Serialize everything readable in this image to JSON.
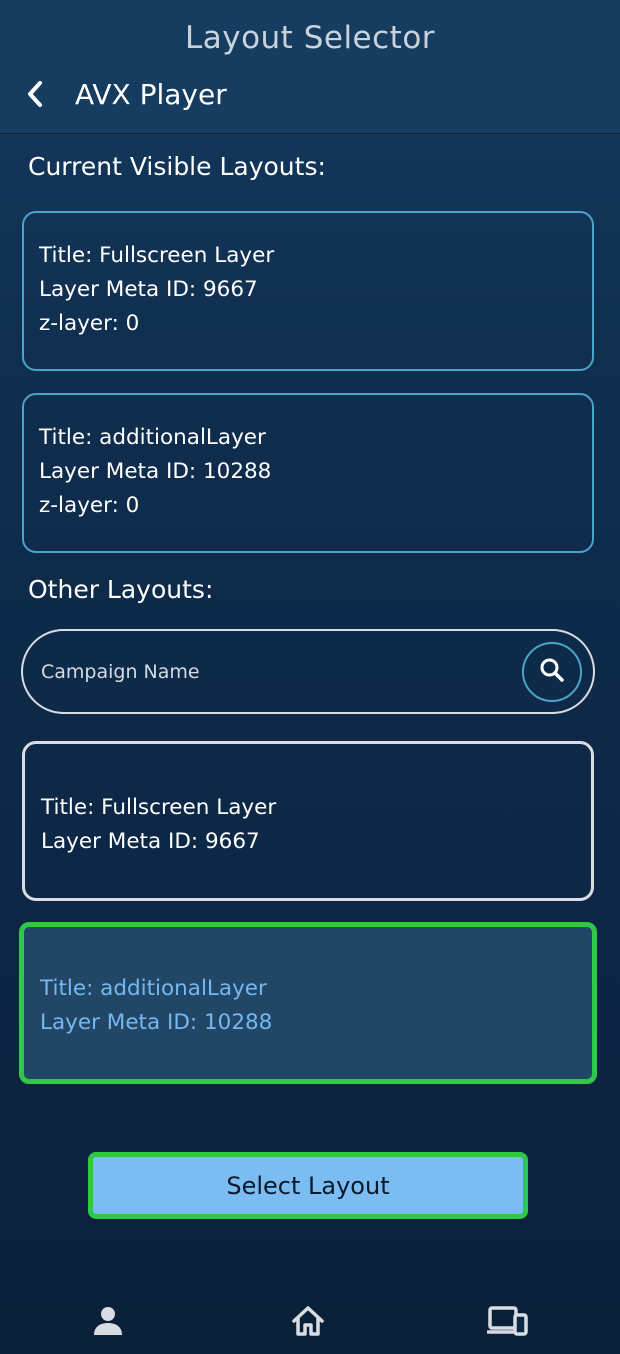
{
  "header": {
    "title": "Layout Selector",
    "back_label": "AVX Player"
  },
  "current_section": {
    "title": "Current Visible Layouts:",
    "cards": [
      {
        "title": "Title: Fullscreen Layer",
        "meta": "Layer Meta ID: 9667",
        "z": "z-layer: 0"
      },
      {
        "title": "Title: additionalLayer",
        "meta": "Layer Meta ID: 10288",
        "z": "z-layer: 0"
      }
    ]
  },
  "other_section": {
    "title": "Other Layouts:",
    "search": {
      "placeholder": "Campaign Name",
      "value": ""
    },
    "cards": [
      {
        "title": "Title: Fullscreen Layer",
        "meta": "Layer Meta ID: 9667",
        "selected": false
      },
      {
        "title": "Title: additionalLayer",
        "meta": "Layer Meta ID: 10288",
        "selected": true
      }
    ]
  },
  "actions": {
    "select_label": "Select Layout"
  },
  "nav": {
    "items": [
      {
        "icon": "person-icon"
      },
      {
        "icon": "home-icon"
      },
      {
        "icon": "devices-icon"
      }
    ]
  },
  "colors": {
    "accent": "#4aa3c8",
    "selection": "#2fc94a",
    "button": "#7bbcf2",
    "selected_text": "#74b8f2"
  }
}
